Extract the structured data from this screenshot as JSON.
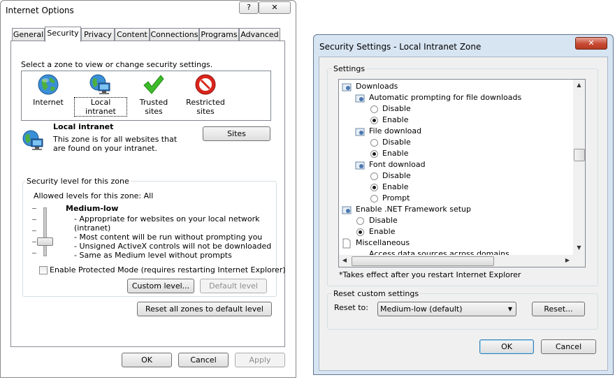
{
  "internet_options": {
    "title": "Internet Options",
    "help_btn": "?",
    "close_btn": "✕",
    "tabs": [
      "General",
      "Security",
      "Privacy",
      "Content",
      "Connections",
      "Programs",
      "Advanced"
    ],
    "zone_prompt": "Select a zone to view or change security settings.",
    "zones": [
      {
        "label": "Internet"
      },
      {
        "label": "Local intranet"
      },
      {
        "label": "Trusted sites"
      },
      {
        "label": "Restricted sites"
      }
    ],
    "zone_info": {
      "name": "Local intranet",
      "description": "This zone is for all websites that are found on your intranet.",
      "sites_button": "Sites"
    },
    "security_level": {
      "group_label": "Security level for this zone",
      "allowed": "Allowed levels for this zone: All",
      "level_name": "Medium-low",
      "bullets": [
        "- Appropriate for websites on your local network",
        "(intranet)",
        "- Most content will be run without prompting you",
        "- Unsigned ActiveX controls will not be downloaded",
        "- Same as Medium level without prompts"
      ],
      "protected_mode": "Enable Protected Mode (requires restarting Internet Explorer)",
      "custom_button": "Custom level...",
      "default_button": "Default level"
    },
    "reset_all_button": "Reset all zones to default level",
    "ok": "OK",
    "cancel": "Cancel",
    "apply": "Apply"
  },
  "security_settings": {
    "title": "Security Settings - Local Intranet Zone",
    "close_btn": "✕",
    "settings_label": "Settings",
    "items": [
      {
        "type": "heading",
        "text": "Downloads",
        "level": 0
      },
      {
        "type": "heading",
        "text": "Automatic prompting for file downloads",
        "level": 1
      },
      {
        "type": "option",
        "text": "Disable",
        "checked": false,
        "level": 2
      },
      {
        "type": "option",
        "text": "Enable",
        "checked": true,
        "level": 2
      },
      {
        "type": "heading",
        "text": "File download",
        "level": 1
      },
      {
        "type": "option",
        "text": "Disable",
        "checked": false,
        "level": 2
      },
      {
        "type": "option",
        "text": "Enable",
        "checked": true,
        "level": 2
      },
      {
        "type": "heading",
        "text": "Font download",
        "level": 1
      },
      {
        "type": "option",
        "text": "Disable",
        "checked": false,
        "level": 2
      },
      {
        "type": "option",
        "text": "Enable",
        "checked": true,
        "level": 2
      },
      {
        "type": "option",
        "text": "Prompt",
        "checked": false,
        "level": 2
      },
      {
        "type": "heading",
        "text": "Enable .NET Framework setup",
        "level": 0
      },
      {
        "type": "option",
        "text": "Disable",
        "checked": false,
        "level": 1
      },
      {
        "type": "option",
        "text": "Enable",
        "checked": true,
        "level": 1
      },
      {
        "type": "page",
        "text": "Miscellaneous",
        "level": 0
      },
      {
        "type": "heading",
        "text": "Access data sources across domains",
        "level": 1
      }
    ],
    "note": "*Takes effect after you restart Internet Explorer",
    "reset_group_label": "Reset custom settings",
    "reset_to_label": "Reset to:",
    "reset_to_value": "Medium-low (default)",
    "reset_button": "Reset...",
    "ok": "OK",
    "cancel": "Cancel"
  },
  "colors": {
    "accent_blue": "#3c7fb1",
    "close_red": "#c74a33",
    "dialog_frame": "#d7e4f2"
  }
}
